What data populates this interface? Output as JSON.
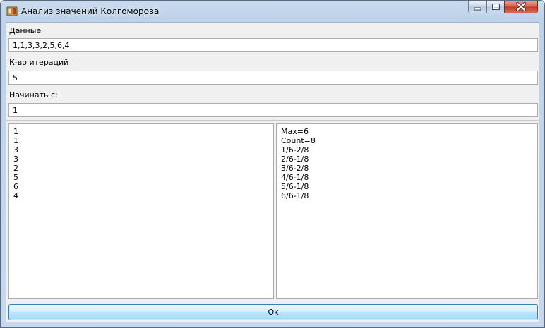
{
  "window": {
    "title": "Анализ значений Колгоморова"
  },
  "form": {
    "data_label": "Данные",
    "data_value": "1,1,3,3,2,5,6,4",
    "iterations_label": "К-во итераций",
    "iterations_value": "5",
    "start_label": "Начинать с:",
    "start_value": "1"
  },
  "input_list": [
    "1",
    "1",
    "3",
    "3",
    "2",
    "5",
    "6",
    "4"
  ],
  "result_list": [
    "Max=6",
    "Count=8",
    "1/6-2/8",
    "2/6-1/8",
    "3/6-2/8",
    "4/6-1/8",
    "5/6-1/8",
    "6/6-1/8"
  ],
  "ok_button": {
    "label": "Ok"
  },
  "icons": {
    "app": "app-icon",
    "minimize": "minimize-icon",
    "maximize": "maximize-icon",
    "close": "close-icon"
  },
  "colors": {
    "title_bar": "#c9dbef",
    "client": "#f0f0f0",
    "close_button": "#c2391f",
    "ok_button": "#bee6fd"
  }
}
